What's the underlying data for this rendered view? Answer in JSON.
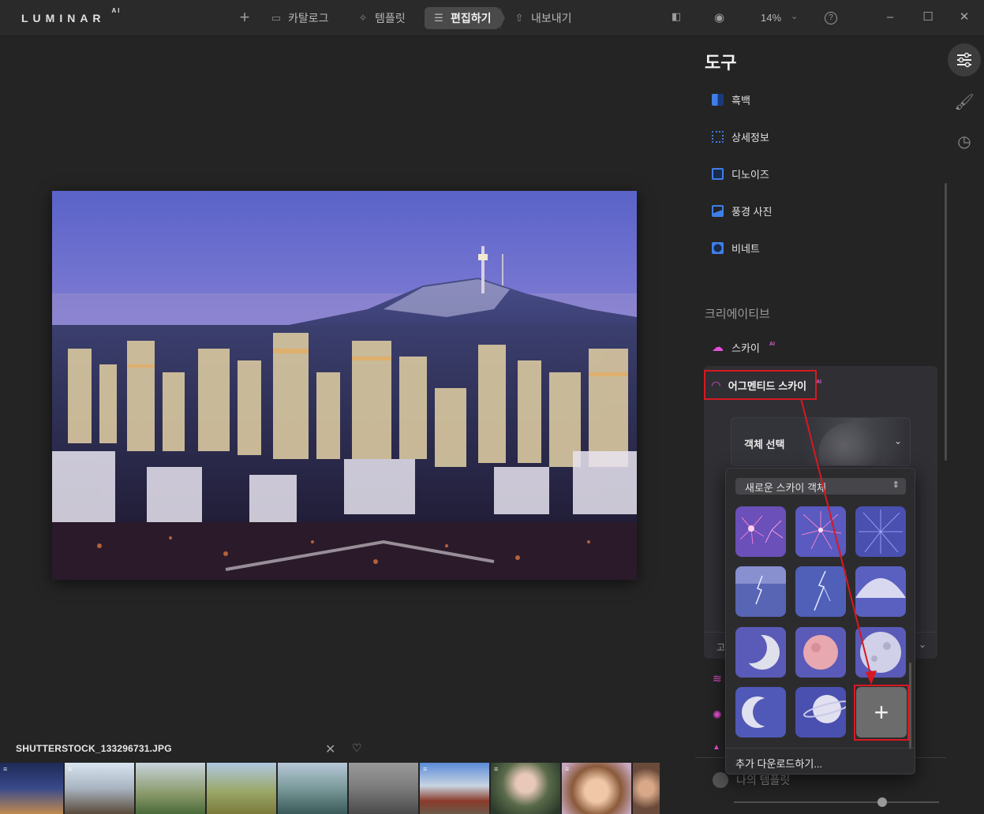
{
  "app": {
    "logo": "LUMINAR",
    "logo_suffix": "AI"
  },
  "topnav": {
    "add_label": "+",
    "catalog": "카탈로그",
    "templates": "템플릿",
    "edit": "편집하기",
    "export": "내보내기"
  },
  "toolbar": {
    "zoom": "14%",
    "help_icon": "?"
  },
  "panel": {
    "title": "도구",
    "tools": [
      {
        "label": "흑백",
        "color": "#3f7ee8"
      },
      {
        "label": "상세정보",
        "color": "#3f7ee8"
      },
      {
        "label": "디노이즈",
        "color": "#3f7ee8"
      },
      {
        "label": "풍경 사진",
        "color": "#3f7ee8"
      },
      {
        "label": "비네트",
        "color": "#3f7ee8"
      }
    ],
    "creative_section": "크리에이티브",
    "creative_tools": [
      {
        "label": "스카이",
        "badge": "AI",
        "color": "#e84fd8"
      },
      {
        "label": "어그멘티드 스카이",
        "badge": "AI",
        "color": "#e84fd8"
      }
    ],
    "object_select": "객체 선택",
    "footer_partial": "고",
    "my_templates": "나의 템플릿"
  },
  "popup": {
    "select_value": "새로운 스카이 객체",
    "download_more": "추가 다운로드하기..."
  },
  "filmstrip": {
    "filename": "SHUTTERSTOCK_133296731.JPG"
  },
  "colors": {
    "accent_magenta": "#e84fd8",
    "accent_blue": "#3f7ee8",
    "highlight_red": "#d71920"
  }
}
